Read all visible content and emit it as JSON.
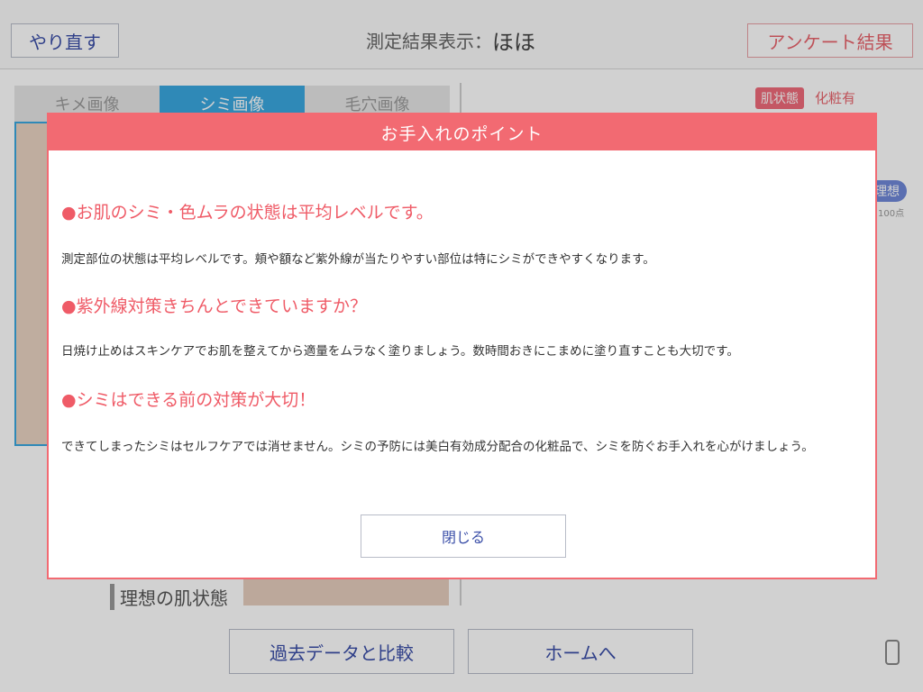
{
  "topbar": {
    "retry_label": "やり直す",
    "title_prefix": "測定結果表示：",
    "title_value": "ほほ",
    "survey_label": "アンケート結果"
  },
  "tabs": [
    {
      "label": "キメ画像"
    },
    {
      "label": "シミ画像"
    },
    {
      "label": "毛穴画像"
    }
  ],
  "side": {
    "skin_badge": "肌状態",
    "makeup_label": "化粧有",
    "ideal_pill": "理想",
    "score_label": "100点"
  },
  "ideal_caption": "理想の肌状態",
  "bottom": {
    "compare_label": "過去データと比較",
    "home_label": "ホームへ"
  },
  "modal": {
    "title": "お手入れのポイント",
    "sections": [
      {
        "title": "●お肌のシミ・色ムラの状態は平均レベルです。",
        "text": "測定部位の状態は平均レベルです。頬や額など紫外線が当たりやすい部位は特にシミができやすくなります。"
      },
      {
        "title": "●紫外線対策きちんとできていますか？",
        "text": "日焼け止めはスキンケアでお肌を整えてから適量をムラなく塗りましょう。数時間おきにこまめに塗り直すことも大切です。"
      },
      {
        "title": "●シミはできる前の対策が大切！",
        "text": "できてしまったシミはセルフケアでは消せません。シミの予防には美白有効成分配合の化粧品で、シミを防ぐお手入れを心がけましょう。"
      }
    ],
    "close_label": "閉じる"
  },
  "colors": {
    "accent": "#f26a72",
    "link_blue": "#3b4fa8",
    "tab_active": "#3aa8e0"
  }
}
